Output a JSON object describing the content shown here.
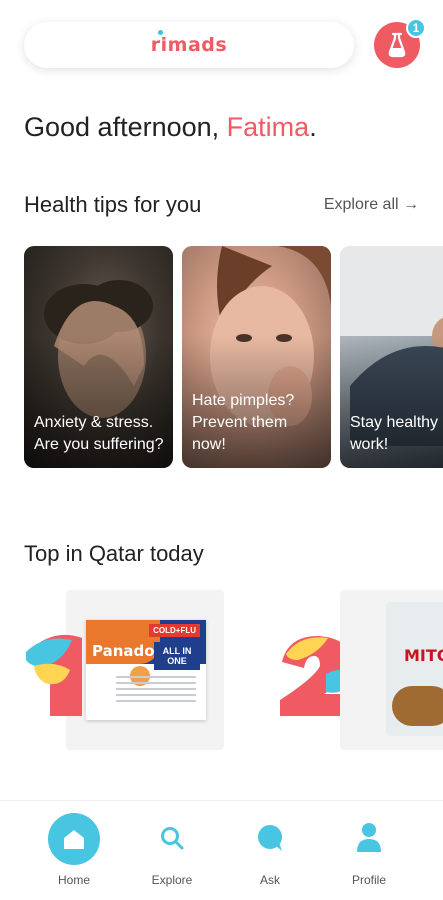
{
  "header": {
    "logo_text": "rimads",
    "notification_count": "1"
  },
  "greeting": {
    "prefix": "Good afternoon, ",
    "name": "Fatima",
    "suffix": "."
  },
  "health_tips": {
    "title": "Health tips for you",
    "explore_label": "Explore all →",
    "cards": [
      {
        "text": "Anxiety & stress. Are you suffering?"
      },
      {
        "text": "Hate pimples? Prevent them now!"
      },
      {
        "text": "Stay healthy at work!"
      }
    ]
  },
  "top_today": {
    "title": "Top in Qatar today",
    "products": [
      {
        "rank": "1",
        "brand": "Panadol",
        "tag": "COLD+FLU",
        "variant": "ALL IN ONE"
      },
      {
        "rank": "2",
        "brand": "MITO"
      }
    ]
  },
  "tabbar": {
    "items": [
      {
        "label": "Home",
        "icon": "home-icon",
        "active": true
      },
      {
        "label": "Explore",
        "icon": "search-icon",
        "active": false
      },
      {
        "label": "Ask",
        "icon": "chat-bubble-icon",
        "active": false
      },
      {
        "label": "Profile",
        "icon": "person-icon",
        "active": false
      }
    ]
  },
  "colors": {
    "brand": "#ef5a63",
    "accent": "#48c5e0"
  }
}
